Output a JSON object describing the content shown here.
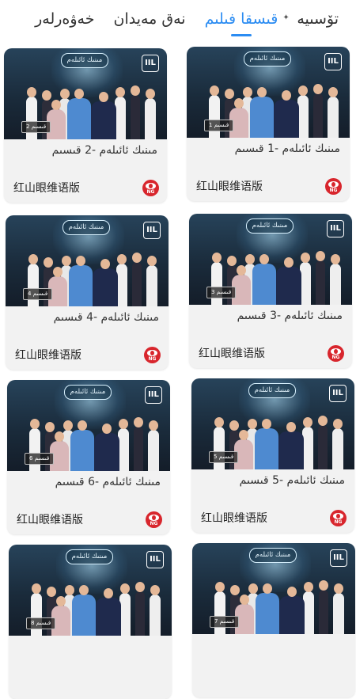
{
  "tabs": [
    {
      "label": "تۆسىيە",
      "active": false
    },
    {
      "label": "قىسقا فىلىم",
      "active": true
    },
    {
      "label": "نەق مەيدان",
      "active": false
    },
    {
      "label": "خەۋەرلەر",
      "active": false
    }
  ],
  "show_logo_text": "مىنىك ئائىلەم",
  "corner_logo_text": "IIL",
  "channel_logo_text": "NG",
  "cards": [
    {
      "title": "مىنىك ئائىلەم  -1  قىسىم",
      "channel": "红山眼维语版",
      "badge": "1 قىسىم"
    },
    {
      "title": "مىنىك ئائىلەم  -2  قىسىم",
      "channel": "红山眼维语版",
      "badge": "2 قىسىم"
    },
    {
      "title": "مىنىك ئائىلەم  -3  قىسىم",
      "channel": "红山眼维语版",
      "badge": "3 قىسىم"
    },
    {
      "title": "مىنىك ئائىلەم  -4  قىسىم",
      "channel": "红山眼维语版",
      "badge": "4 قىسىم"
    },
    {
      "title": "مىنىك ئائىلەم  -5  قىسىم",
      "channel": "红山眼维语版",
      "badge": "5 قىسىم"
    },
    {
      "title": "مىنىك ئائىلەم  -6  قىسىم",
      "channel": "红山眼维语版",
      "badge": "6 قىسىم"
    },
    {
      "title": "",
      "channel": "",
      "badge": "7 قىسىم"
    },
    {
      "title": "",
      "channel": "",
      "badge": "8 قىسىم"
    }
  ],
  "colors": {
    "accent": "#2b8cf2",
    "channel_logo": "#d8262d"
  }
}
